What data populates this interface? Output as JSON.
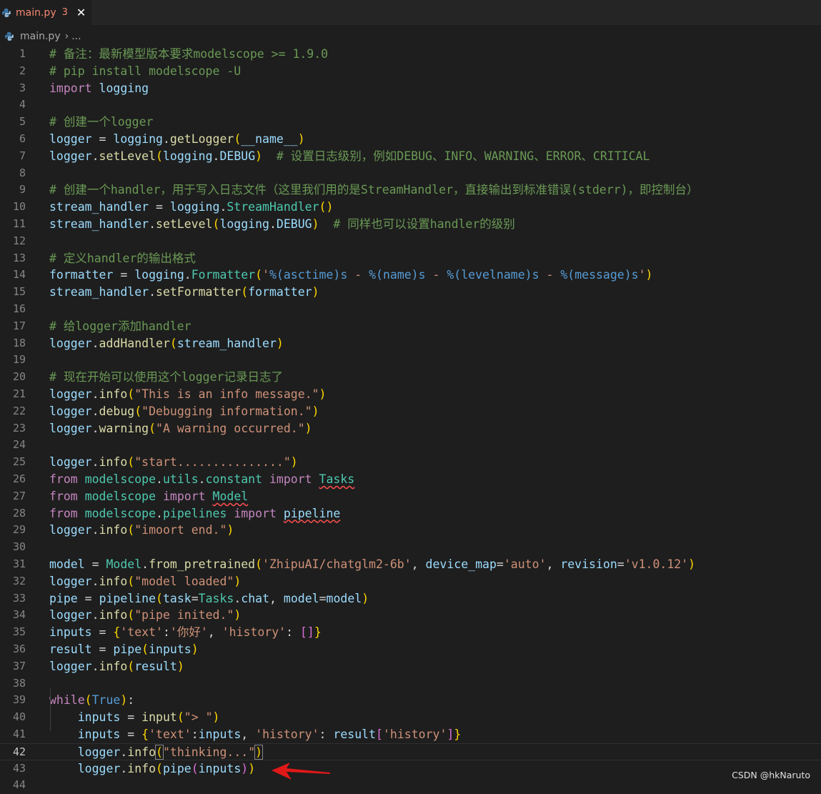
{
  "tab": {
    "filename": "main.py",
    "problems": "3",
    "close_glyph": "✕"
  },
  "breadcrumb": {
    "file": "main.py",
    "separator": "›",
    "more": "..."
  },
  "watermark": "CSDN @hkNaruto",
  "colors": {
    "accent_error": "#f14c4c",
    "keyword": "#c586c0",
    "string": "#ce9178",
    "comment": "#6a9955",
    "function": "#dcdcaa",
    "variable": "#9cdcfe",
    "class": "#4ec9b0"
  },
  "active_line": 42,
  "lines": [
    {
      "n": "1",
      "t": [
        [
          "# 备注：最新模型版本要求modelscope >= 1.9.0",
          "com"
        ]
      ]
    },
    {
      "n": "2",
      "t": [
        [
          "# pip install modelscope -U",
          "com"
        ]
      ]
    },
    {
      "n": "3",
      "t": [
        [
          "import",
          "kw"
        ],
        [
          " ",
          "w"
        ],
        [
          "logging",
          "var"
        ]
      ]
    },
    {
      "n": "4",
      "t": []
    },
    {
      "n": "5",
      "t": [
        [
          "# 创建一个logger",
          "com"
        ]
      ]
    },
    {
      "n": "6",
      "t": [
        [
          "logger",
          "var"
        ],
        [
          " = ",
          "w"
        ],
        [
          "logging",
          "var"
        ],
        [
          ".",
          "w"
        ],
        [
          "getLogger",
          "fn"
        ],
        [
          "(",
          "p1"
        ],
        [
          "__name__",
          "var"
        ],
        [
          ")",
          "p1"
        ]
      ]
    },
    {
      "n": "7",
      "t": [
        [
          "logger",
          "var"
        ],
        [
          ".",
          "w"
        ],
        [
          "setLevel",
          "fn"
        ],
        [
          "(",
          "p1"
        ],
        [
          "logging",
          "var"
        ],
        [
          ".",
          "w"
        ],
        [
          "DEBUG",
          "var"
        ],
        [
          ")",
          "p1"
        ],
        [
          "  # 设置日志级别，例如DEBUG、INFO、WARNING、ERROR、CRITICAL",
          "com"
        ]
      ]
    },
    {
      "n": "8",
      "t": []
    },
    {
      "n": "9",
      "t": [
        [
          "# 创建一个handler，用于写入日志文件（这里我们用的是StreamHandler，直接输出到标准错误(stderr)，即控制台）",
          "com"
        ]
      ]
    },
    {
      "n": "10",
      "t": [
        [
          "stream_handler",
          "var"
        ],
        [
          " = ",
          "w"
        ],
        [
          "logging",
          "var"
        ],
        [
          ".",
          "w"
        ],
        [
          "StreamHandler",
          "cls"
        ],
        [
          "()",
          "p1"
        ]
      ]
    },
    {
      "n": "11",
      "t": [
        [
          "stream_handler",
          "var"
        ],
        [
          ".",
          "w"
        ],
        [
          "setLevel",
          "fn"
        ],
        [
          "(",
          "p1"
        ],
        [
          "logging",
          "var"
        ],
        [
          ".",
          "w"
        ],
        [
          "DEBUG",
          "var"
        ],
        [
          ")",
          "p1"
        ],
        [
          "  # 同样也可以设置handler的级别",
          "com"
        ]
      ]
    },
    {
      "n": "12",
      "t": []
    },
    {
      "n": "13",
      "t": [
        [
          "# 定义handler的输出格式",
          "com"
        ]
      ]
    },
    {
      "n": "14",
      "t": [
        [
          "formatter",
          "var"
        ],
        [
          " = ",
          "w"
        ],
        [
          "logging",
          "var"
        ],
        [
          ".",
          "w"
        ],
        [
          "Formatter",
          "cls"
        ],
        [
          "(",
          "p1"
        ],
        [
          "'",
          "str"
        ],
        [
          "%(asctime)s",
          "fmt"
        ],
        [
          " - ",
          "str"
        ],
        [
          "%(name)s",
          "fmt"
        ],
        [
          " - ",
          "str"
        ],
        [
          "%(levelname)s",
          "fmt"
        ],
        [
          " - ",
          "str"
        ],
        [
          "%(message)s",
          "fmt"
        ],
        [
          "'",
          "str"
        ],
        [
          ")",
          "p1"
        ]
      ]
    },
    {
      "n": "15",
      "t": [
        [
          "stream_handler",
          "var"
        ],
        [
          ".",
          "w"
        ],
        [
          "setFormatter",
          "fn"
        ],
        [
          "(",
          "p1"
        ],
        [
          "formatter",
          "var"
        ],
        [
          ")",
          "p1"
        ]
      ]
    },
    {
      "n": "16",
      "t": []
    },
    {
      "n": "17",
      "t": [
        [
          "# 给logger添加handler",
          "com"
        ]
      ]
    },
    {
      "n": "18",
      "t": [
        [
          "logger",
          "var"
        ],
        [
          ".",
          "w"
        ],
        [
          "addHandler",
          "fn"
        ],
        [
          "(",
          "p1"
        ],
        [
          "stream_handler",
          "var"
        ],
        [
          ")",
          "p1"
        ]
      ]
    },
    {
      "n": "19",
      "t": []
    },
    {
      "n": "20",
      "t": [
        [
          "# 现在开始可以使用这个logger记录日志了",
          "com"
        ]
      ]
    },
    {
      "n": "21",
      "t": [
        [
          "logger",
          "var"
        ],
        [
          ".",
          "w"
        ],
        [
          "info",
          "fn"
        ],
        [
          "(",
          "p1"
        ],
        [
          "\"This is an info message.\"",
          "str"
        ],
        [
          ")",
          "p1"
        ]
      ]
    },
    {
      "n": "22",
      "t": [
        [
          "logger",
          "var"
        ],
        [
          ".",
          "w"
        ],
        [
          "debug",
          "fn"
        ],
        [
          "(",
          "p1"
        ],
        [
          "\"Debugging information.\"",
          "str"
        ],
        [
          ")",
          "p1"
        ]
      ]
    },
    {
      "n": "23",
      "t": [
        [
          "logger",
          "var"
        ],
        [
          ".",
          "w"
        ],
        [
          "warning",
          "fn"
        ],
        [
          "(",
          "p1"
        ],
        [
          "\"A warning occurred.\"",
          "str"
        ],
        [
          ")",
          "p1"
        ]
      ]
    },
    {
      "n": "24",
      "t": []
    },
    {
      "n": "25",
      "t": [
        [
          "logger",
          "var"
        ],
        [
          ".",
          "w"
        ],
        [
          "info",
          "fn"
        ],
        [
          "(",
          "p1"
        ],
        [
          "\"start...............\"",
          "str"
        ],
        [
          ")",
          "p1"
        ]
      ]
    },
    {
      "n": "26",
      "t": [
        [
          "from",
          "kw"
        ],
        [
          " ",
          "w"
        ],
        [
          "modelscope",
          "cls"
        ],
        [
          ".",
          "w"
        ],
        [
          "utils",
          "cls"
        ],
        [
          ".",
          "w"
        ],
        [
          "constant",
          "cls"
        ],
        [
          " ",
          "w"
        ],
        [
          "import",
          "kw"
        ],
        [
          " ",
          "w"
        ],
        [
          "Tasks",
          "cls",
          "sq"
        ]
      ]
    },
    {
      "n": "27",
      "t": [
        [
          "from",
          "kw"
        ],
        [
          " ",
          "w"
        ],
        [
          "modelscope",
          "cls"
        ],
        [
          " ",
          "w"
        ],
        [
          "import",
          "kw"
        ],
        [
          " ",
          "w"
        ],
        [
          "Model",
          "cls",
          "sq"
        ]
      ]
    },
    {
      "n": "28",
      "t": [
        [
          "from",
          "kw"
        ],
        [
          " ",
          "w"
        ],
        [
          "modelscope",
          "cls"
        ],
        [
          ".",
          "w"
        ],
        [
          "pipelines",
          "cls"
        ],
        [
          " ",
          "w"
        ],
        [
          "import",
          "kw"
        ],
        [
          " ",
          "w"
        ],
        [
          "pipeline",
          "var",
          "sq"
        ]
      ]
    },
    {
      "n": "29",
      "t": [
        [
          "logger",
          "var"
        ],
        [
          ".",
          "w"
        ],
        [
          "info",
          "fn"
        ],
        [
          "(",
          "p1"
        ],
        [
          "\"imoort end.\"",
          "str"
        ],
        [
          ")",
          "p1"
        ]
      ]
    },
    {
      "n": "30",
      "t": []
    },
    {
      "n": "31",
      "t": [
        [
          "model",
          "var"
        ],
        [
          " = ",
          "w"
        ],
        [
          "Model",
          "cls"
        ],
        [
          ".",
          "w"
        ],
        [
          "from_pretrained",
          "fn"
        ],
        [
          "(",
          "p1"
        ],
        [
          "'ZhipuAI/chatglm2-6b'",
          "str"
        ],
        [
          ", ",
          "w"
        ],
        [
          "device_map",
          "var"
        ],
        [
          "=",
          "w"
        ],
        [
          "'auto'",
          "str"
        ],
        [
          ", ",
          "w"
        ],
        [
          "revision",
          "var"
        ],
        [
          "=",
          "w"
        ],
        [
          "'v1.0.12'",
          "str"
        ],
        [
          ")",
          "p1"
        ]
      ]
    },
    {
      "n": "32",
      "t": [
        [
          "logger",
          "var"
        ],
        [
          ".",
          "w"
        ],
        [
          "info",
          "fn"
        ],
        [
          "(",
          "p1"
        ],
        [
          "\"model loaded\"",
          "str"
        ],
        [
          ")",
          "p1"
        ]
      ]
    },
    {
      "n": "33",
      "t": [
        [
          "pipe",
          "var"
        ],
        [
          " = ",
          "w"
        ],
        [
          "pipeline",
          "var"
        ],
        [
          "(",
          "p1"
        ],
        [
          "task",
          "var"
        ],
        [
          "=",
          "w"
        ],
        [
          "Tasks",
          "cls"
        ],
        [
          ".",
          "w"
        ],
        [
          "chat",
          "var"
        ],
        [
          ", ",
          "w"
        ],
        [
          "model",
          "var"
        ],
        [
          "=",
          "w"
        ],
        [
          "model",
          "var"
        ],
        [
          ")",
          "p1"
        ]
      ]
    },
    {
      "n": "34",
      "t": [
        [
          "logger",
          "var"
        ],
        [
          ".",
          "w"
        ],
        [
          "info",
          "fn"
        ],
        [
          "(",
          "p1"
        ],
        [
          "\"pipe inited.\"",
          "str"
        ],
        [
          ")",
          "p1"
        ]
      ]
    },
    {
      "n": "35",
      "t": [
        [
          "inputs",
          "var"
        ],
        [
          " = ",
          "w"
        ],
        [
          "{",
          "p1"
        ],
        [
          "'text'",
          "str"
        ],
        [
          ":",
          "w"
        ],
        [
          "'你好'",
          "str"
        ],
        [
          ", ",
          "w"
        ],
        [
          "'history'",
          "str"
        ],
        [
          ": ",
          "w"
        ],
        [
          "[]",
          "p2"
        ],
        [
          "}",
          "p1"
        ]
      ]
    },
    {
      "n": "36",
      "t": [
        [
          "result",
          "var"
        ],
        [
          " = ",
          "w"
        ],
        [
          "pipe",
          "var"
        ],
        [
          "(",
          "p1"
        ],
        [
          "inputs",
          "var"
        ],
        [
          ")",
          "p1"
        ]
      ]
    },
    {
      "n": "37",
      "t": [
        [
          "logger",
          "var"
        ],
        [
          ".",
          "w"
        ],
        [
          "info",
          "fn"
        ],
        [
          "(",
          "p1"
        ],
        [
          "result",
          "var"
        ],
        [
          ")",
          "p1"
        ]
      ]
    },
    {
      "n": "38",
      "t": []
    },
    {
      "n": "39",
      "t": [
        [
          "while",
          "kw"
        ],
        [
          "(",
          "p1"
        ],
        [
          "True",
          "bool"
        ],
        [
          ")",
          "p1"
        ],
        [
          ":",
          "w"
        ]
      ]
    },
    {
      "n": "40",
      "t": [
        [
          "    ",
          "w"
        ],
        [
          "inputs",
          "var"
        ],
        [
          " = ",
          "w"
        ],
        [
          "input",
          "fn"
        ],
        [
          "(",
          "p1"
        ],
        [
          "\"> \"",
          "str"
        ],
        [
          ")",
          "p1"
        ]
      ]
    },
    {
      "n": "41",
      "t": [
        [
          "    ",
          "w"
        ],
        [
          "inputs",
          "var"
        ],
        [
          " = ",
          "w"
        ],
        [
          "{",
          "p1"
        ],
        [
          "'text'",
          "str"
        ],
        [
          ":",
          "w"
        ],
        [
          "inputs",
          "var"
        ],
        [
          ", ",
          "w"
        ],
        [
          "'history'",
          "str"
        ],
        [
          ": ",
          "w"
        ],
        [
          "result",
          "var"
        ],
        [
          "[",
          "p2"
        ],
        [
          "'history'",
          "str"
        ],
        [
          "]",
          "p2"
        ],
        [
          "}",
          "p1"
        ]
      ]
    },
    {
      "n": "42",
      "t": [
        [
          "    ",
          "w"
        ],
        [
          "logger",
          "var"
        ],
        [
          ".",
          "w"
        ],
        [
          "info",
          "fn"
        ],
        [
          "(",
          "p1",
          "bm"
        ],
        [
          "\"thinking...\"",
          "str"
        ],
        [
          ")",
          "p1",
          "bm"
        ]
      ]
    },
    {
      "n": "43",
      "t": [
        [
          "    ",
          "w"
        ],
        [
          "logger",
          "var"
        ],
        [
          ".",
          "w"
        ],
        [
          "info",
          "fn"
        ],
        [
          "(",
          "p1"
        ],
        [
          "pipe",
          "var"
        ],
        [
          "(",
          "p2"
        ],
        [
          "inputs",
          "var"
        ],
        [
          ")",
          "p2"
        ],
        [
          ")",
          "p1"
        ]
      ]
    },
    {
      "n": "44",
      "t": []
    }
  ]
}
